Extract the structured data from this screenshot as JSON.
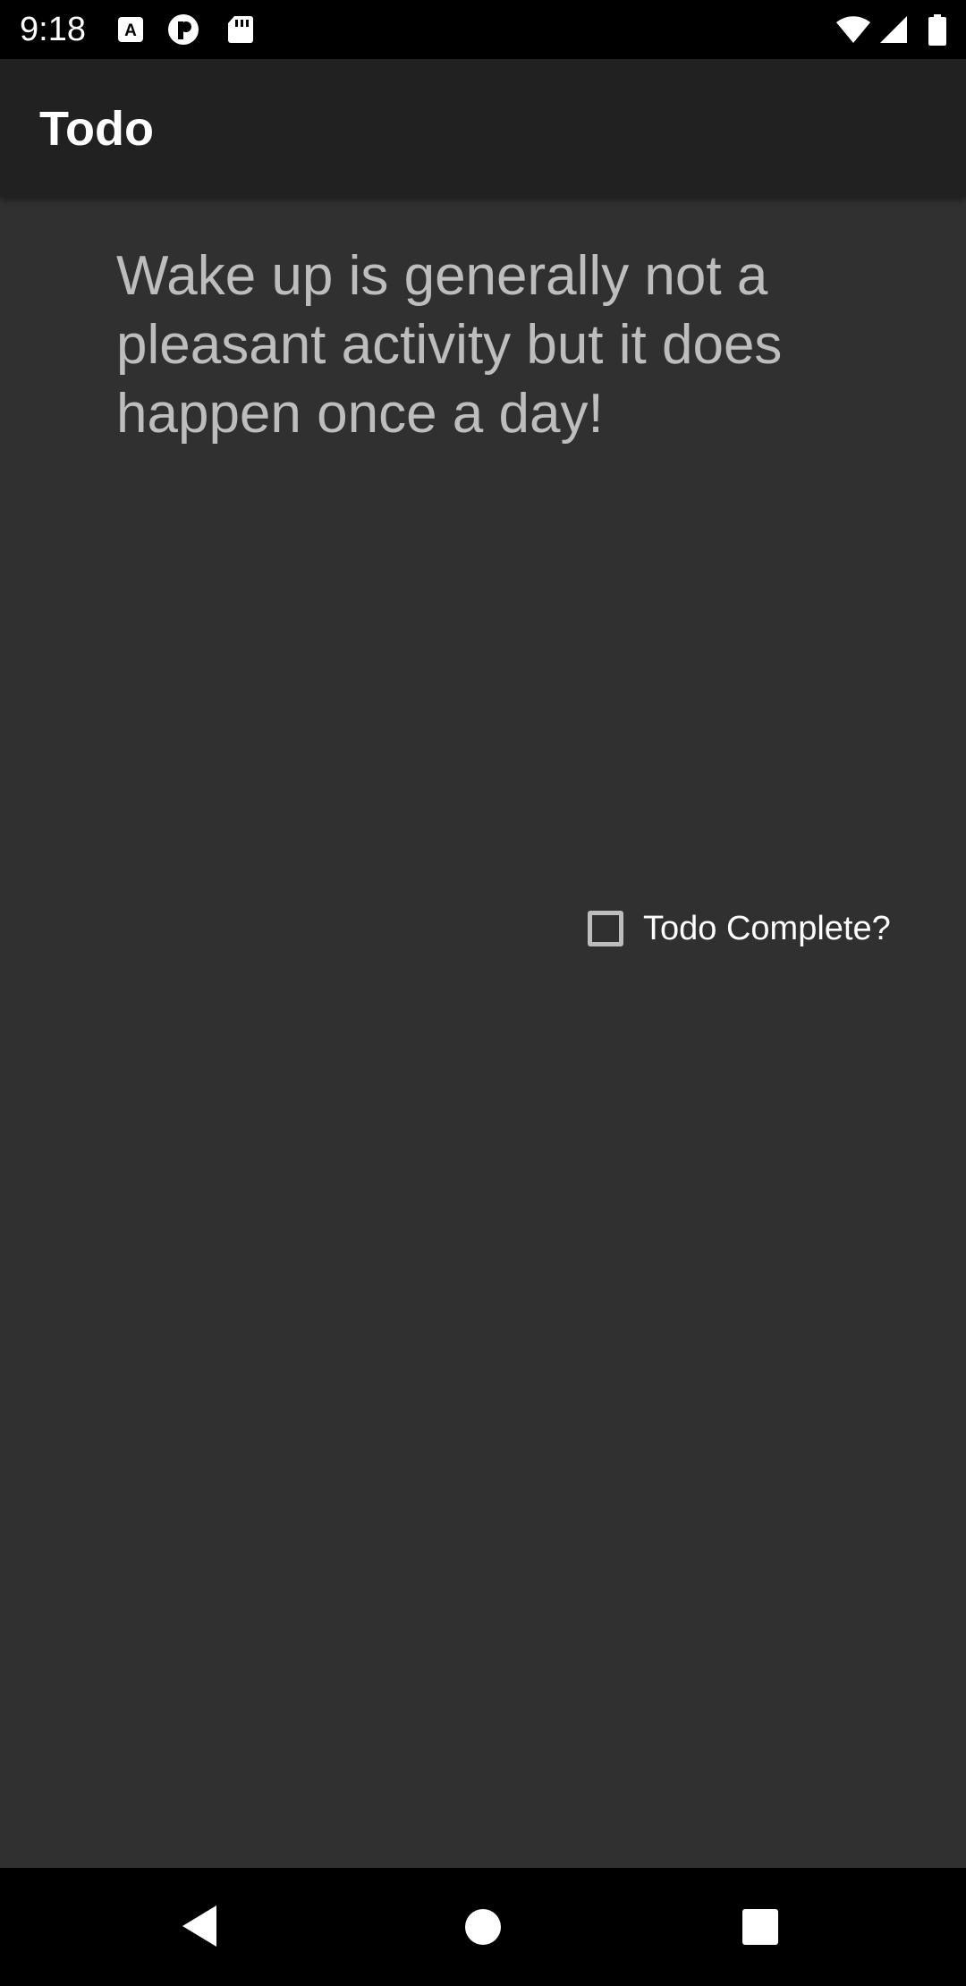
{
  "status_bar": {
    "time": "9:18",
    "left_icons": [
      "font-a-icon",
      "circle-p-icon",
      "sd-card-icon"
    ],
    "right_icons": [
      "wifi-icon",
      "signal-icon",
      "battery-icon"
    ]
  },
  "app_bar": {
    "title": "Todo",
    "background": "#212121"
  },
  "todo": {
    "description": "Wake up is generally not a pleasant activity but it does happen once a day!",
    "complete_label": "Todo Complete?",
    "complete_checked": false
  },
  "nav_bar": {
    "buttons": [
      "back-icon",
      "home-icon",
      "recents-icon"
    ]
  },
  "colors": {
    "background": "#303030",
    "text_secondary": "#bdbdbd",
    "text_primary": "#ffffff"
  }
}
